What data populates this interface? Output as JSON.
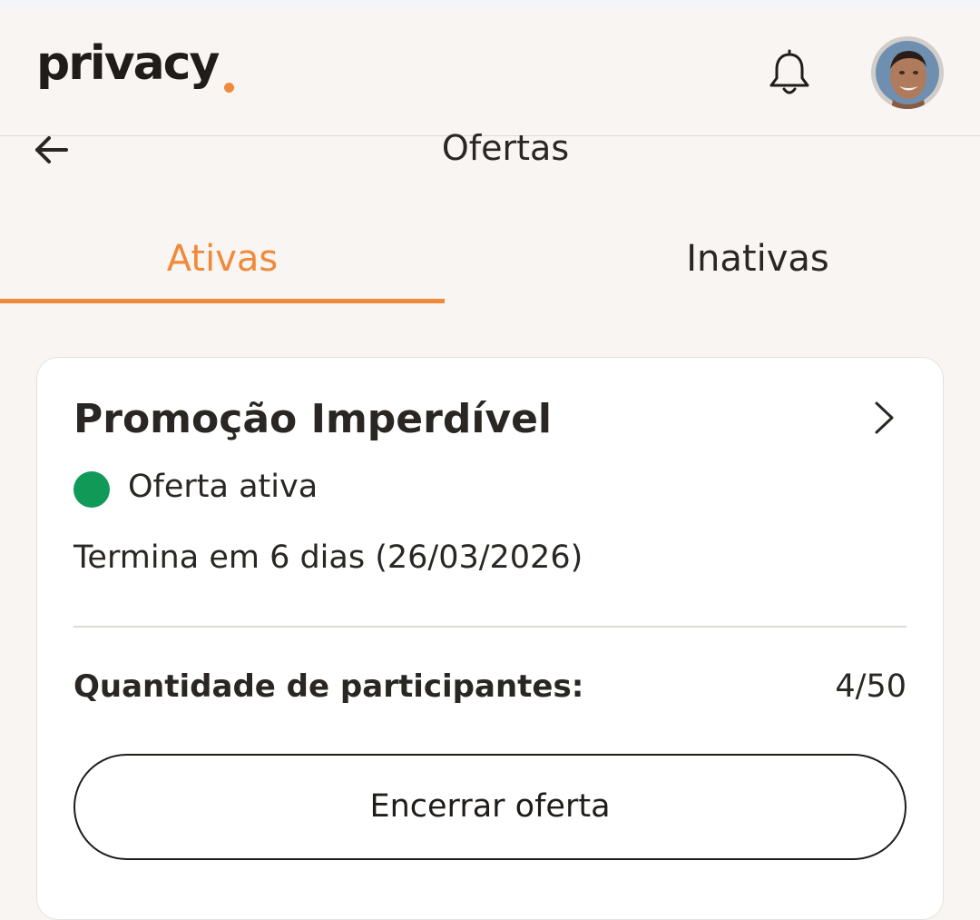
{
  "header": {
    "logo_text": "privacy",
    "logo_dot_color": "#f08a3a",
    "notification_icon": "bell-icon",
    "avatar_alt": "user-avatar"
  },
  "subheader": {
    "back_icon": "arrow-left-icon",
    "title": "Ofertas"
  },
  "tabs": [
    {
      "label": "Ativas",
      "active": true
    },
    {
      "label": "Inativas",
      "active": false
    }
  ],
  "accent_color": "#f08a3a",
  "offer": {
    "title": "Promoção Imperdível",
    "chevron_icon": "chevron-right-icon",
    "status_label": "Oferta ativa",
    "status_color": "#119a57",
    "ends_text": "Termina em 6 dias (26/03/2026)",
    "participants_label": "Quantidade de participantes:",
    "participants_value": "4/50",
    "end_button_label": "Encerrar oferta"
  }
}
